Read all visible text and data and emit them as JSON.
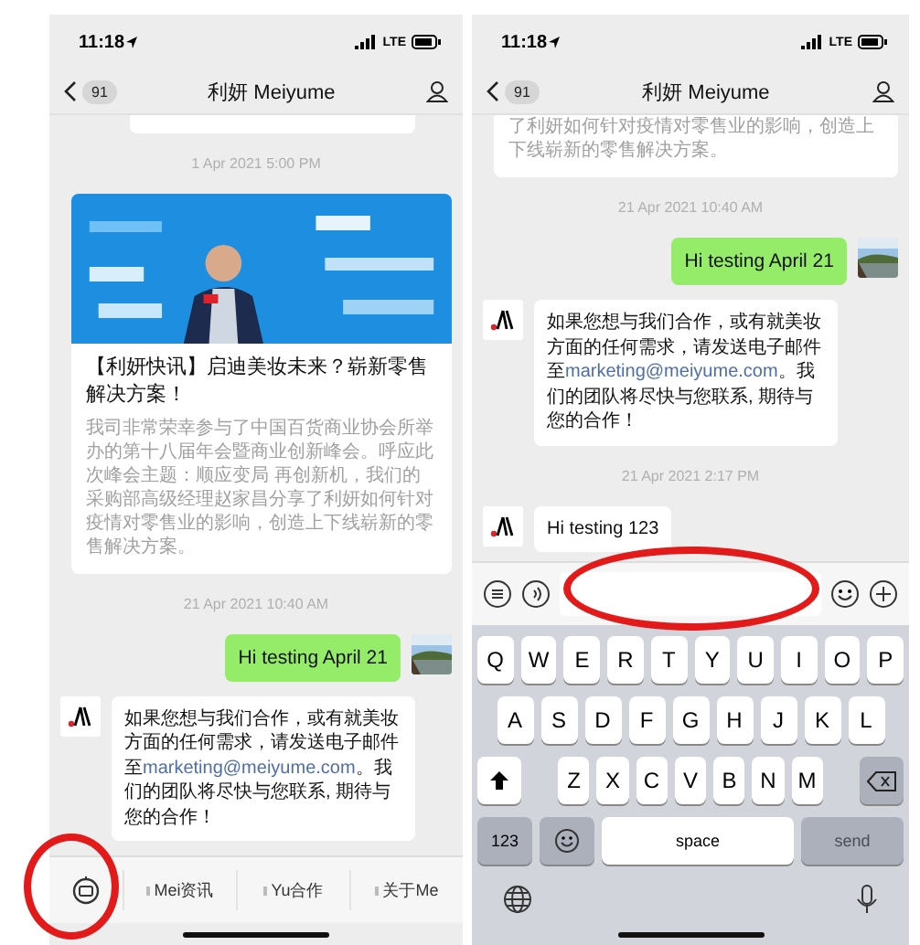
{
  "phones": [
    {
      "status_bar": {
        "time": "11:18",
        "network": "LTE"
      },
      "header": {
        "back_count": "91",
        "title": "利妍 Meiyume"
      },
      "messages": [
        {
          "kind": "cut"
        },
        {
          "kind": "timestamp",
          "text": "1 Apr 2021 5:00 PM"
        },
        {
          "kind": "article",
          "title": "【利妍快讯】启迪美妆未来？崭新零售解决方案！",
          "body": "我司非常荣幸参与了中国百货商业协会所举办的第十八届年会暨商业创新峰会。呼应此次峰会主题：顺应变局 再创新机，我们的采购部高级经理赵家昌分享了利妍如何针对疫情对零售业的影响，创造上下线崭新的零售解决方案。"
        },
        {
          "kind": "timestamp",
          "text": "21 Apr 2021 10:40 AM"
        },
        {
          "kind": "sent",
          "text": "Hi testing April 21"
        },
        {
          "kind": "received",
          "text_before": "如果您想与我们合作，或有就美妆方面的任何需求，请发送电子邮件至",
          "link": "marketing@meiyume.com",
          "text_after": "。我们的团队将尽快与您联系, 期待与您的合作！"
        }
      ],
      "menu": {
        "items": [
          "Mei资讯",
          "Yu合作",
          "关于Me"
        ]
      }
    },
    {
      "status_bar": {
        "time": "11:18",
        "network": "LTE"
      },
      "header": {
        "back_count": "91",
        "title": "利妍 Meiyume"
      },
      "messages": [
        {
          "kind": "article",
          "body": "了利妍如何针对疫情对零售业的影响，创造上下线崭新的零售解决方案。"
        },
        {
          "kind": "timestamp",
          "text": "21 Apr 2021 10:40 AM"
        },
        {
          "kind": "sent",
          "text": "Hi testing April 21"
        },
        {
          "kind": "received",
          "text_before": "如果您想与我们合作，或有就美妆方面的任何需求，请发送电子邮件至",
          "link": "marketing@meiyume.com",
          "text_after": "。我们的团队将尽快与您联系, 期待与您的合作！"
        },
        {
          "kind": "timestamp",
          "text": "21 Apr 2021 2:17 PM"
        },
        {
          "kind": "received",
          "text_before": "Hi testing 123"
        }
      ],
      "keyboard": {
        "rows": [
          [
            "Q",
            "W",
            "E",
            "R",
            "T",
            "Y",
            "U",
            "I",
            "O",
            "P"
          ],
          [
            "A",
            "S",
            "D",
            "F",
            "G",
            "H",
            "J",
            "K",
            "L"
          ],
          [
            "Z",
            "X",
            "C",
            "V",
            "B",
            "N",
            "M"
          ]
        ],
        "bottom": [
          {
            "kind": "numbers",
            "label": "123"
          },
          {
            "kind": "emoji"
          },
          {
            "kind": "space",
            "label": "space"
          },
          {
            "kind": "send",
            "label": "send",
            "disabled": true
          }
        ]
      }
    }
  ]
}
